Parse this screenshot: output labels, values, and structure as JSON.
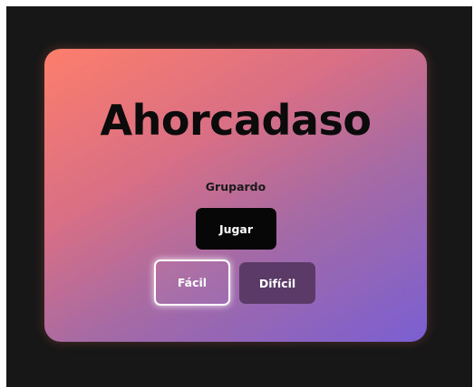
{
  "game": {
    "title": "Ahorcadaso",
    "subtitle": "Grupardo"
  },
  "buttons": {
    "play_label": "Jugar",
    "easy_label": "Fácil",
    "hard_label": "Difícil",
    "selected_difficulty": "Fácil"
  },
  "colors": {
    "background": "#171717",
    "card_gradient_start": "#fd7e6b",
    "card_gradient_end": "#7a5fd2",
    "play_button": "#070707",
    "hard_button": "#5c3a67"
  }
}
